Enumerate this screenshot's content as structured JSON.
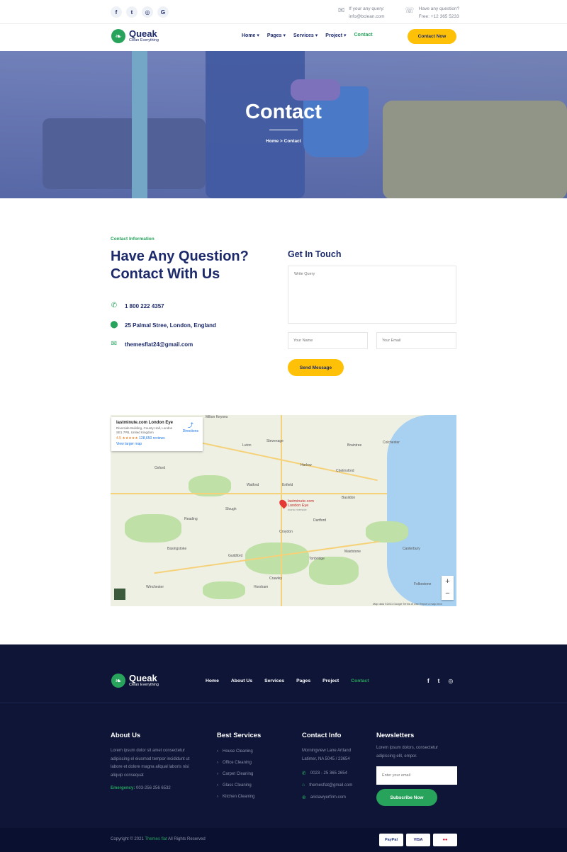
{
  "topbar": {
    "social": [
      {
        "icon": "facebook-icon",
        "glyph": "f"
      },
      {
        "icon": "twitter-icon",
        "glyph": "t"
      },
      {
        "icon": "instagram-icon",
        "glyph": "◎"
      },
      {
        "icon": "google-icon",
        "glyph": "G"
      }
    ],
    "email_label": "If your any query:",
    "email_value": "info@bclean.com",
    "phone_label": "Have any question?",
    "phone_value": "Free: +12 365 5233"
  },
  "header": {
    "brand": "Queak",
    "tagline": "Clean Everything",
    "nav": [
      {
        "label": "Home",
        "has_dropdown": true
      },
      {
        "label": "Pages",
        "has_dropdown": true
      },
      {
        "label": "Services",
        "has_dropdown": true
      },
      {
        "label": "Project",
        "has_dropdown": true
      },
      {
        "label": "Contact",
        "active": true
      }
    ],
    "cta": "Contact Now"
  },
  "hero": {
    "title": "Contact",
    "breadcrumb_home": "Home",
    "breadcrumb_sep": ">",
    "breadcrumb_current": "Contact"
  },
  "contact": {
    "eyebrow": "Contact Information",
    "headline": "Have Any Question? Contact With Us",
    "phone": "1 800 222 4357",
    "address": "25 Palmal Stree, London, England",
    "email": "themesflat24@gmail.com",
    "form_title": "Get In Touch",
    "query_placeholder": "Write Query",
    "name_placeholder": "Your Name",
    "email_placeholder": "Your Email",
    "submit": "Send Message"
  },
  "map": {
    "place_title": "lastminute.com London Eye",
    "place_address": "Riverside Building, County Hall, London SE1 7PB, United Kingdom",
    "rating": "4.5 ★★★★★",
    "reviews": "128,650 reviews",
    "larger_map": "View larger map",
    "directions": "Directions",
    "pin_label_1": "lastminute.com",
    "pin_label_2": "London Eye",
    "pin_label_3": "Iconic riverside",
    "zoom_in": "+",
    "zoom_out": "−",
    "footer_text": "Map data ©2021 Google   Terms of Use   Report a map error",
    "towns": [
      {
        "name": "Milton Keynes"
      },
      {
        "name": "Luton"
      },
      {
        "name": "Stevenage"
      },
      {
        "name": "Oxford"
      },
      {
        "name": "Harlow"
      },
      {
        "name": "Chelmsford"
      },
      {
        "name": "Colchester"
      },
      {
        "name": "Watford"
      },
      {
        "name": "Enfield"
      },
      {
        "name": "Slough"
      },
      {
        "name": "Reading"
      },
      {
        "name": "Croydon"
      },
      {
        "name": "Dartford"
      },
      {
        "name": "Basildon"
      },
      {
        "name": "Guildford"
      },
      {
        "name": "Crawley"
      },
      {
        "name": "Maidstone"
      },
      {
        "name": "Canterbury"
      },
      {
        "name": "Tonbridge"
      },
      {
        "name": "Basingstoke"
      },
      {
        "name": "Horsham"
      },
      {
        "name": "Winchester"
      },
      {
        "name": "Folkestone"
      },
      {
        "name": "Braintree"
      }
    ]
  },
  "footer": {
    "brand": "Queak",
    "tagline": "Clean Everything",
    "nav": [
      {
        "label": "Home"
      },
      {
        "label": "About Us"
      },
      {
        "label": "Services"
      },
      {
        "label": "Pages"
      },
      {
        "label": "Project"
      },
      {
        "label": "Contact",
        "active": true
      }
    ],
    "social": [
      {
        "icon": "facebook-icon",
        "glyph": "f"
      },
      {
        "icon": "twitter-icon",
        "glyph": "t"
      },
      {
        "icon": "instagram-icon",
        "glyph": "◎"
      }
    ],
    "about_title": "About Us",
    "about_text": "Lorem ipsum dolor sit amet consectetur adipiscing el eiusmod tempor incididunt ut labore et dolore magna aliqual laboris nisi aliquip consequat",
    "emergency_label": "Emergency:",
    "emergency_value": "003-256 256 6532",
    "services_title": "Best Services",
    "services": [
      "House Cleaning",
      "Office Cleaning",
      "Carpet Cleaning",
      "Glass Cleaning",
      "Kitchen Cleaning"
    ],
    "contact_title": "Contact Info",
    "contact_address": "Morningview Lane Artland Latimer, NA 5045 / 23654",
    "contact_phone": "0023 - 25 365 2654",
    "contact_email": "themesflat@gmail.com",
    "contact_web": "ariclawyerfirm.com",
    "newsletter_title": "Newsletters",
    "newsletter_text": "Lorem ipsum dolors, consectetur adipiscing elit, empor.",
    "newsletter_placeholder": "Enter your email",
    "subscribe": "Subscribe Now",
    "copyright_pre": "Copyright © 2021",
    "copyright_brand": "Themes flat",
    "copyright_post": "All Rights Reserved",
    "payments": [
      "PayPal",
      "VISA",
      "●●"
    ]
  },
  "colors": {
    "navy": "#1c2a6b",
    "green": "#28a35c",
    "yellow": "#ffc107",
    "footer_bg": "#0e1537"
  }
}
